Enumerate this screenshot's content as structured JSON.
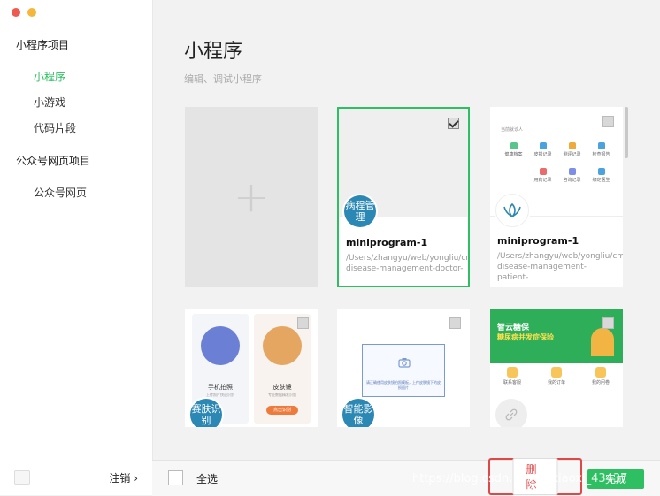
{
  "sidebar": {
    "section1_title": "小程序项目",
    "items1": [
      {
        "label": "小程序",
        "active": true
      },
      {
        "label": "小游戏"
      },
      {
        "label": "代码片段"
      }
    ],
    "section2_title": "公众号网页项目",
    "items2": [
      {
        "label": "公众号网页"
      }
    ],
    "logout_label": "注销 ›"
  },
  "main": {
    "title": "小程序",
    "subtitle": "编辑、调试小程序"
  },
  "projects": [
    {
      "name": "miniprogram-1",
      "path": "/Users/zhangyu/web/yongliu/cmv-disease-management-doctor-",
      "logo_text": "病程管理",
      "selected": true
    },
    {
      "name": "miniprogram-1",
      "path": "/Users/zhangyu/web/yongliu/cmv-disease-management-patient-",
      "logo_text": "",
      "selected": false,
      "thumb_header": "当前就诊人",
      "thumb_items": [
        "健康档案",
        "皮损记录",
        "测评记录",
        "检查报告",
        "用药记录",
        "咨询记录",
        "绑定医生"
      ]
    },
    {
      "logo_text": "赛肤识别",
      "thumb_items": [
        "手机拍照",
        "皮肤镜"
      ],
      "thumb_sub": [
        "上传照片快速识别",
        "专业数据精准识别"
      ],
      "thumb_btn": "点击识别"
    },
    {
      "logo_text": "智能影像",
      "thumb_caption": "请正确使用皮肤镜拍照模板，上传皮肤镜下的皮损图片"
    },
    {
      "logo_text": "",
      "banner_title": "智云糖保",
      "banner_sub": "糖尿病并发症保险",
      "thumb_items": [
        "联系客服",
        "我的订单",
        "我的问卷"
      ]
    }
  ],
  "bottom": {
    "select_all": "全选",
    "delete": "删除",
    "done": "完成"
  },
  "watermark": "https://blog.csdn.net/zaixiaoxi_43437",
  "colors": {
    "accent": "#2fbf63",
    "danger": "#e04848"
  }
}
